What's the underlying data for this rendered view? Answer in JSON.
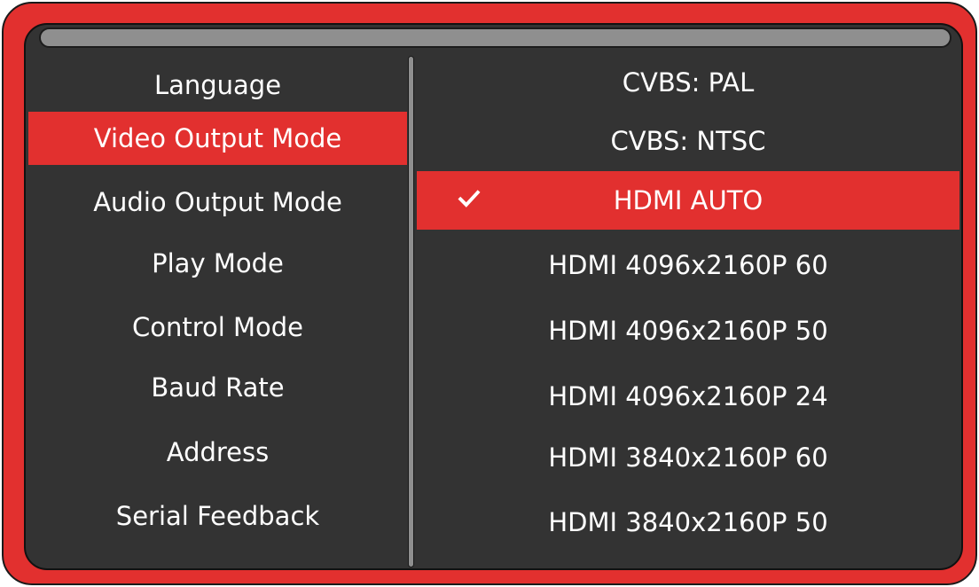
{
  "left_menu": {
    "items": [
      {
        "label": "Language"
      },
      {
        "label": "Video Output Mode"
      },
      {
        "label": "Audio Output Mode"
      },
      {
        "label": "Play Mode"
      },
      {
        "label": "Control Mode"
      },
      {
        "label": "Baud Rate"
      },
      {
        "label": "Address"
      },
      {
        "label": "Serial Feedback"
      }
    ],
    "selected_index": 1
  },
  "right_menu": {
    "items": [
      {
        "label": "CVBS: PAL"
      },
      {
        "label": "CVBS: NTSC"
      },
      {
        "label": "HDMI AUTO",
        "checked": true
      },
      {
        "label": "HDMI 4096x2160P 60"
      },
      {
        "label": "HDMI 4096x2160P 50"
      },
      {
        "label": "HDMI 4096x2160P 24"
      },
      {
        "label": "HDMI 3840x2160P 60"
      },
      {
        "label": "HDMI 3840x2160P 50"
      }
    ],
    "selected_index": 2,
    "check_icon": "checkmark-icon"
  },
  "colors": {
    "accent": "#e2302f",
    "panel": "#333333",
    "bar": "#8f8f8f",
    "text": "#ffffff"
  }
}
